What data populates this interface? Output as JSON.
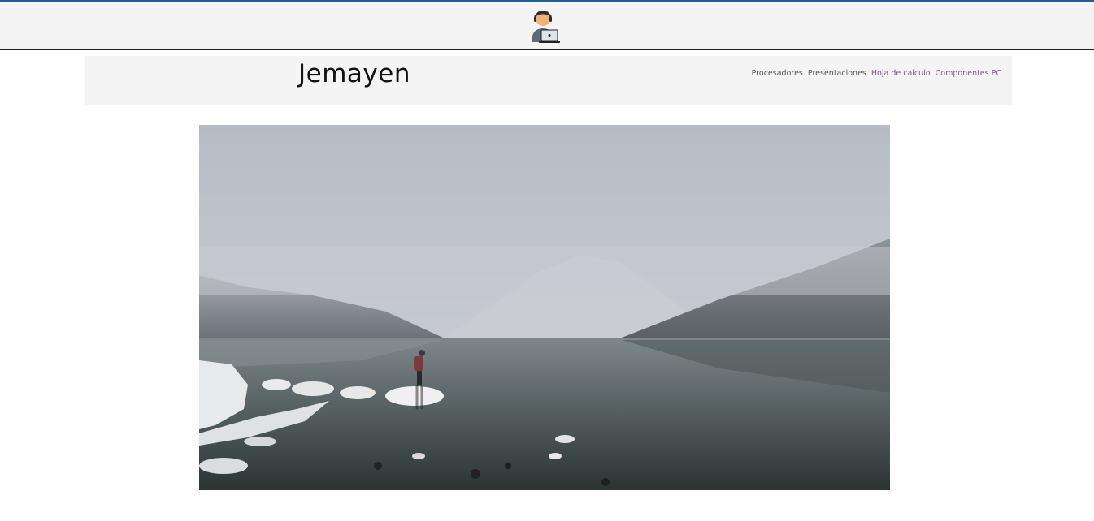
{
  "topbar": {
    "logo_icon": "developer-with-laptop-icon",
    "accent_color": "#1f5f9a"
  },
  "header": {
    "title": "Jemayen",
    "nav": [
      {
        "label": "Procesadores",
        "color": "#555555"
      },
      {
        "label": "Presentaciones",
        "color": "#555555"
      },
      {
        "label": "Hoja de calculo",
        "color": "#7a5c8a"
      },
      {
        "label": "Componentes PC",
        "color": "#7a5c8a"
      }
    ]
  },
  "hero": {
    "image_icon": "foggy-lake-photo"
  }
}
